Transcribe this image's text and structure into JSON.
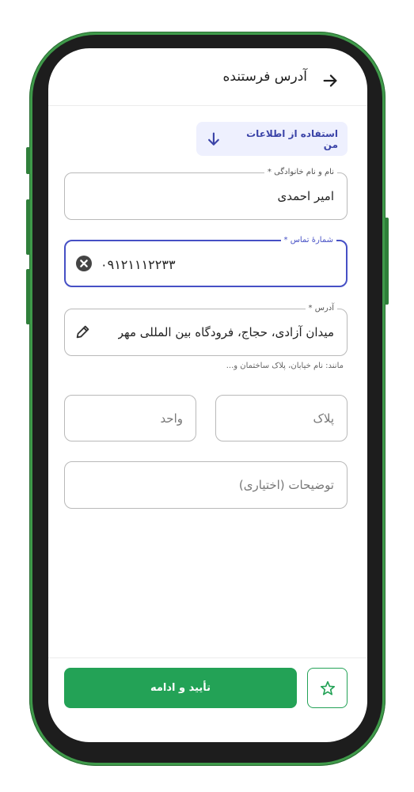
{
  "header": {
    "title": "آدرس فرستنده",
    "back_icon": "arrow-right-icon"
  },
  "use_my_info": {
    "label": "استفاده از اطلاعات من",
    "icon": "arrow-down-icon"
  },
  "form": {
    "name": {
      "legend": "نام و نام خانوادگی *",
      "value": "امیر احمدی"
    },
    "phone": {
      "legend": "شمارهٔ تماس *",
      "value": "۰۹۱۲۱۱۱۲۲۳۳",
      "clear_icon": "clear-circle-icon"
    },
    "address": {
      "legend": "آدرس *",
      "value": "میدان آزادی، حجاج، فرودگاه بین المللی مهر",
      "helper": "مانند: نام خیابان، پلاک ساختمان و...",
      "edit_icon": "pencil-icon"
    },
    "plaque": {
      "placeholder": "پلاک"
    },
    "unit": {
      "placeholder": "واحد"
    },
    "notes": {
      "placeholder": "توضیحات (اختیاری)"
    }
  },
  "footer": {
    "confirm_label": "تأیید و ادامه",
    "favorite_icon": "star-icon"
  },
  "colors": {
    "primary_green": "#23a256",
    "focus_blue": "#4650c5",
    "info_bg": "#eef0fe",
    "frame_green": "#3f9a4a"
  }
}
